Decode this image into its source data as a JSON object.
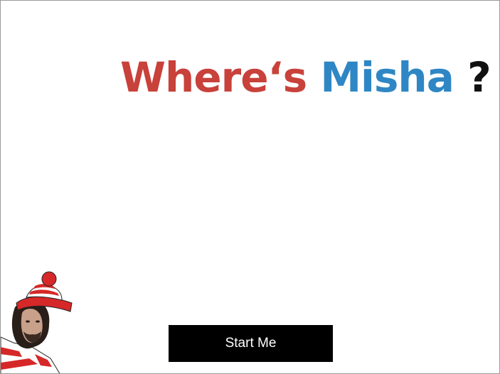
{
  "title": {
    "word1": "Where‘s",
    "word2": "Misha",
    "mark": "?"
  },
  "start_button": {
    "label": "Start Me"
  },
  "colors": {
    "title_red": "#c8413a",
    "title_blue": "#2f86c4",
    "button_bg": "#000000",
    "button_text": "#ffffff"
  },
  "icons": {
    "character": "misha-character-icon"
  }
}
